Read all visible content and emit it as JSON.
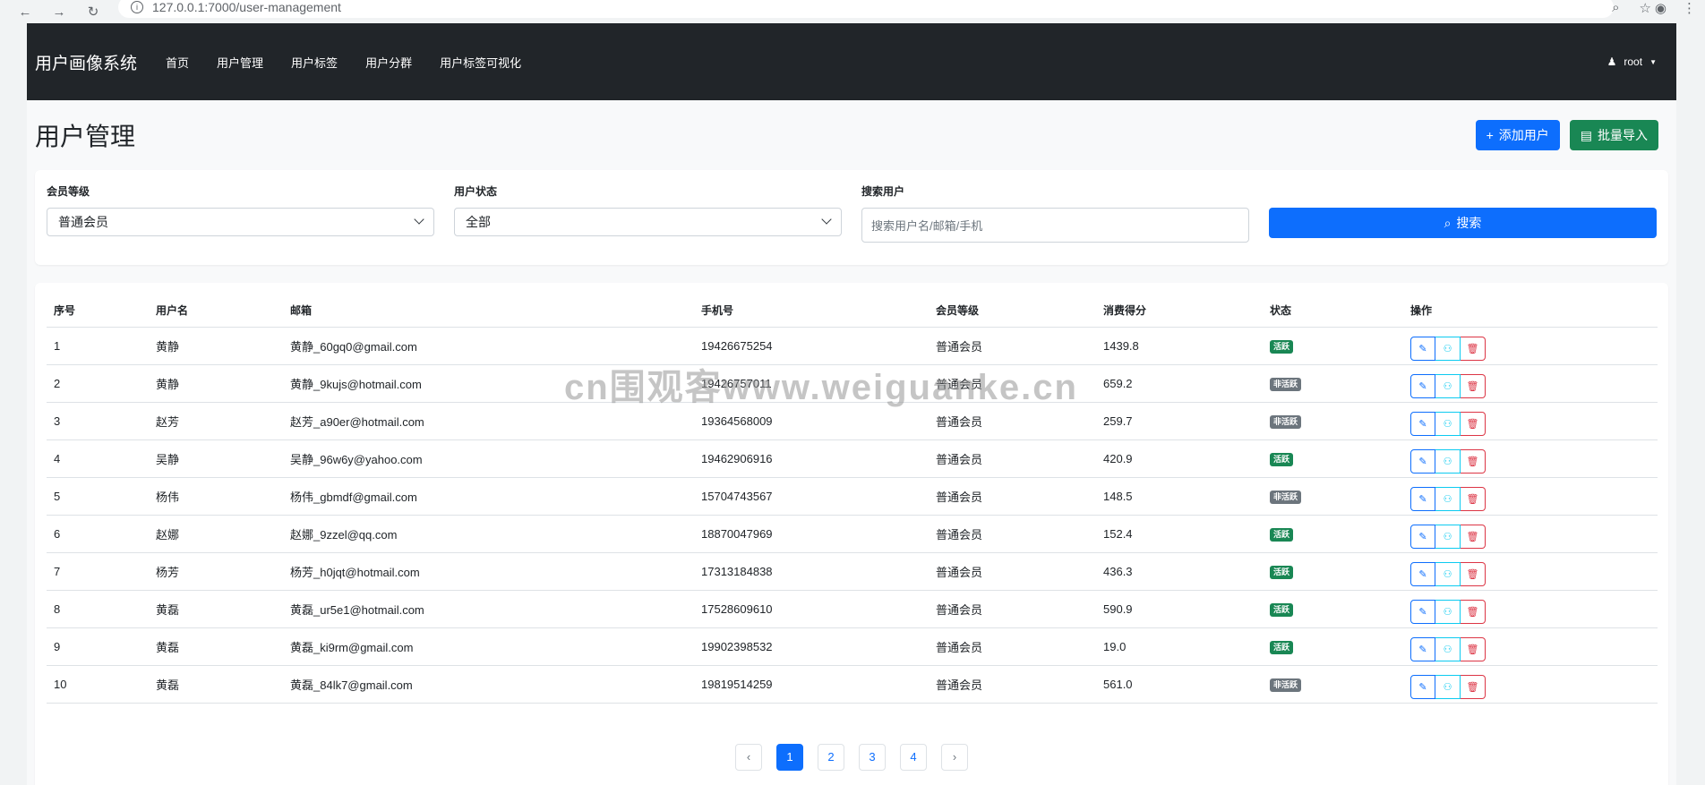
{
  "browser": {
    "url": "127.0.0.1:7000/user-management"
  },
  "navbar": {
    "brand": "用户画像系统",
    "links": [
      "首页",
      "用户管理",
      "用户标签",
      "用户分群",
      "用户标签可视化"
    ],
    "user": "root"
  },
  "page": {
    "title": "用户管理",
    "add_user_label": "添加用户",
    "import_label": "批量导入"
  },
  "filters": {
    "member_level_label": "会员等级",
    "member_level_value": "普通会员",
    "status_label": "用户状态",
    "status_value": "全部",
    "search_label": "搜索用户",
    "search_placeholder": "搜索用户名/邮箱/手机",
    "search_button": "搜索"
  },
  "table": {
    "headers": [
      "序号",
      "用户名",
      "邮箱",
      "手机号",
      "会员等级",
      "消费得分",
      "状态",
      "操作"
    ],
    "rows": [
      {
        "id": "1",
        "name": "黄静",
        "email": "黄静_60gq0@gmail.com",
        "phone": "19426675254",
        "level": "普通会员",
        "score": "1439.8",
        "status": "活跃"
      },
      {
        "id": "2",
        "name": "黄静",
        "email": "黄静_9kujs@hotmail.com",
        "phone": "19426757011",
        "level": "普通会员",
        "score": "659.2",
        "status": "非活跃"
      },
      {
        "id": "3",
        "name": "赵芳",
        "email": "赵芳_a90er@hotmail.com",
        "phone": "19364568009",
        "level": "普通会员",
        "score": "259.7",
        "status": "非活跃"
      },
      {
        "id": "4",
        "name": "吴静",
        "email": "吴静_96w6y@yahoo.com",
        "phone": "19462906916",
        "level": "普通会员",
        "score": "420.9",
        "status": "活跃"
      },
      {
        "id": "5",
        "name": "杨伟",
        "email": "杨伟_gbmdf@gmail.com",
        "phone": "15704743567",
        "level": "普通会员",
        "score": "148.5",
        "status": "非活跃"
      },
      {
        "id": "6",
        "name": "赵娜",
        "email": "赵娜_9zzel@qq.com",
        "phone": "18870047969",
        "level": "普通会员",
        "score": "152.4",
        "status": "活跃"
      },
      {
        "id": "7",
        "name": "杨芳",
        "email": "杨芳_h0jqt@hotmail.com",
        "phone": "17313184838",
        "level": "普通会员",
        "score": "436.3",
        "status": "活跃"
      },
      {
        "id": "8",
        "name": "黄磊",
        "email": "黄磊_ur5e1@hotmail.com",
        "phone": "17528609610",
        "level": "普通会员",
        "score": "590.9",
        "status": "活跃"
      },
      {
        "id": "9",
        "name": "黄磊",
        "email": "黄磊_ki9rm@gmail.com",
        "phone": "19902398532",
        "level": "普通会员",
        "score": "19.0",
        "status": "活跃"
      },
      {
        "id": "10",
        "name": "黄磊",
        "email": "黄磊_84lk7@gmail.com",
        "phone": "19819514259",
        "level": "普通会员",
        "score": "561.0",
        "status": "非活跃"
      }
    ]
  },
  "pagination": {
    "pages": [
      "1",
      "2",
      "3",
      "4"
    ],
    "current": "1",
    "prev": "‹",
    "next": "›"
  },
  "watermark": "cn围观客www.weiguanke.cn",
  "colors": {
    "primary": "#0d6efd",
    "success": "#198754",
    "secondary": "#6c757d",
    "danger": "#dc3545",
    "info": "#0dcaf0",
    "navbar": "#212529"
  }
}
